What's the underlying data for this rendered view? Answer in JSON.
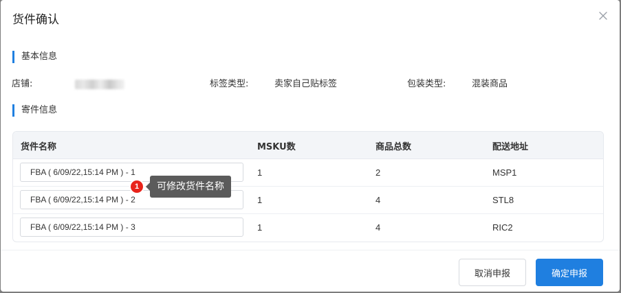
{
  "dialog": {
    "title": "货件确认"
  },
  "basic_info": {
    "section_title": "基本信息",
    "store_label": "店铺:",
    "label_type_label": "标签类型:",
    "label_type_value": "卖家自己贴标签",
    "package_type_label": "包装类型:",
    "package_type_value": "混装商品"
  },
  "shipment_info": {
    "section_title": "寄件信息"
  },
  "table": {
    "headers": [
      "货件名称",
      "MSKU数",
      "商品总数",
      "配送地址"
    ],
    "rows": [
      {
        "name": "FBA ( 6/09/22,15:14 PM ) - 1",
        "msku": "1",
        "total": "2",
        "address": "MSP1"
      },
      {
        "name": "FBA ( 6/09/22,15:14 PM ) - 2",
        "msku": "1",
        "total": "4",
        "address": "STL8"
      },
      {
        "name": "FBA ( 6/09/22,15:14 PM ) - 3",
        "msku": "1",
        "total": "4",
        "address": "RIC2"
      }
    ]
  },
  "tooltip": {
    "badge": "1",
    "text": "可修改货件名称"
  },
  "footer": {
    "cancel_label": "取消申报",
    "confirm_label": "确定申报"
  },
  "colors": {
    "accent": "#1f7fe0",
    "badge": "#e8231a",
    "tooltip_bg": "#5b5b5b"
  },
  "icons": {
    "close": "close-icon"
  }
}
